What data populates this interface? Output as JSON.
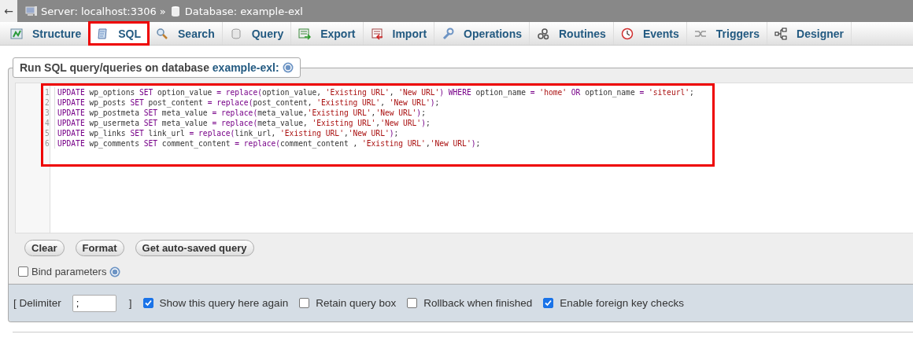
{
  "back_arrow": "←",
  "breadcrumb": {
    "server": "Server: localhost:3306",
    "separator": "»",
    "database": "Database: example-exl"
  },
  "tabs": [
    {
      "label": "Structure",
      "selected": false,
      "highlighted": false
    },
    {
      "label": "SQL",
      "selected": true,
      "highlighted": true
    },
    {
      "label": "Search",
      "selected": false,
      "highlighted": false
    },
    {
      "label": "Query",
      "selected": false,
      "highlighted": false
    },
    {
      "label": "Export",
      "selected": false,
      "highlighted": false
    },
    {
      "label": "Import",
      "selected": false,
      "highlighted": false
    },
    {
      "label": "Operations",
      "selected": false,
      "highlighted": false
    },
    {
      "label": "Routines",
      "selected": false,
      "highlighted": false
    },
    {
      "label": "Events",
      "selected": false,
      "highlighted": false
    },
    {
      "label": "Triggers",
      "selected": false,
      "highlighted": false
    },
    {
      "label": "Designer",
      "selected": false,
      "highlighted": false
    }
  ],
  "legend": {
    "text": "Run SQL query/queries on database ",
    "database": "example-exl:"
  },
  "editor": {
    "highlighted": true,
    "lines": [
      {
        "number": "1",
        "code": "UPDATE wp_options SET option_value = replace(option_value, 'Existing URL', 'New URL') WHERE option_name = 'home' OR option_name = 'siteurl';"
      },
      {
        "number": "2",
        "code": "UPDATE wp_posts SET post_content = replace(post_content, 'Existing URL', 'New URL');"
      },
      {
        "number": "3",
        "code": "UPDATE wp_postmeta SET meta_value = replace(meta_value,'Existing URL','New URL');"
      },
      {
        "number": "4",
        "code": "UPDATE wp_usermeta SET meta_value = replace(meta_value, 'Existing URL','New URL');"
      },
      {
        "number": "5",
        "code": "UPDATE wp_links SET link_url = replace(link_url, 'Existing URL','New URL');"
      },
      {
        "number": "6",
        "code": "UPDATE wp_comments SET comment_content = replace(comment_content , 'Existing URL','New URL');"
      }
    ]
  },
  "buttons": [
    "Clear",
    "Format",
    "Get auto-saved query"
  ],
  "bind_parameters": {
    "label": "Bind parameters",
    "checked": false
  },
  "options": {
    "delimiter_label": "[ Delimiter",
    "delimiter_value": ";",
    "delimiter_close": "]",
    "checkboxes": [
      {
        "label": "Show this query here again",
        "checked": true
      },
      {
        "label": "Retain query box",
        "checked": false
      },
      {
        "label": "Rollback when finished",
        "checked": false
      },
      {
        "label": "Enable foreign key checks",
        "checked": true
      }
    ]
  }
}
